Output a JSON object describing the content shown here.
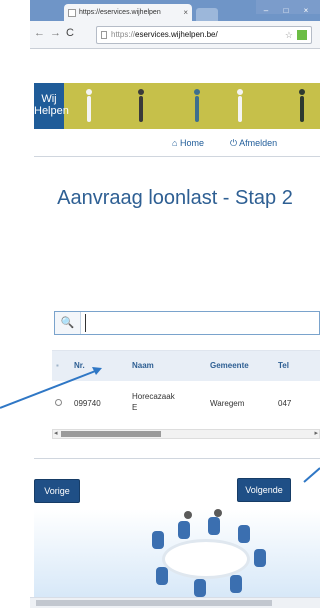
{
  "browser": {
    "tab_title": "https://eservices.wijhelpen",
    "tab_close": "×",
    "url_prefix": "https://",
    "url_domain": "eservices.wijhelpen.be/",
    "window_controls": [
      "–",
      "□",
      "×"
    ]
  },
  "header": {
    "logo": "Wij Helpen",
    "brand_color": "#1f5c99",
    "banner_color": "#c6c04a"
  },
  "nav": {
    "home": "Home",
    "logout": "Afmelden"
  },
  "main": {
    "title": "Aanvraag loonlast - Stap 2",
    "search_placeholder": "",
    "table": {
      "headers": [
        "Nr.",
        "Naam",
        "Gemeente",
        "Tel"
      ],
      "rows": [
        {
          "nr": "099740",
          "naam": "Horecazaak E",
          "gemeente": "Waregem",
          "tel": "047"
        }
      ]
    },
    "prev_button": "Vorige",
    "next_button": "Volgende"
  },
  "icons": {
    "search": "search-icon",
    "home": "home-icon",
    "logout": "power-icon"
  }
}
